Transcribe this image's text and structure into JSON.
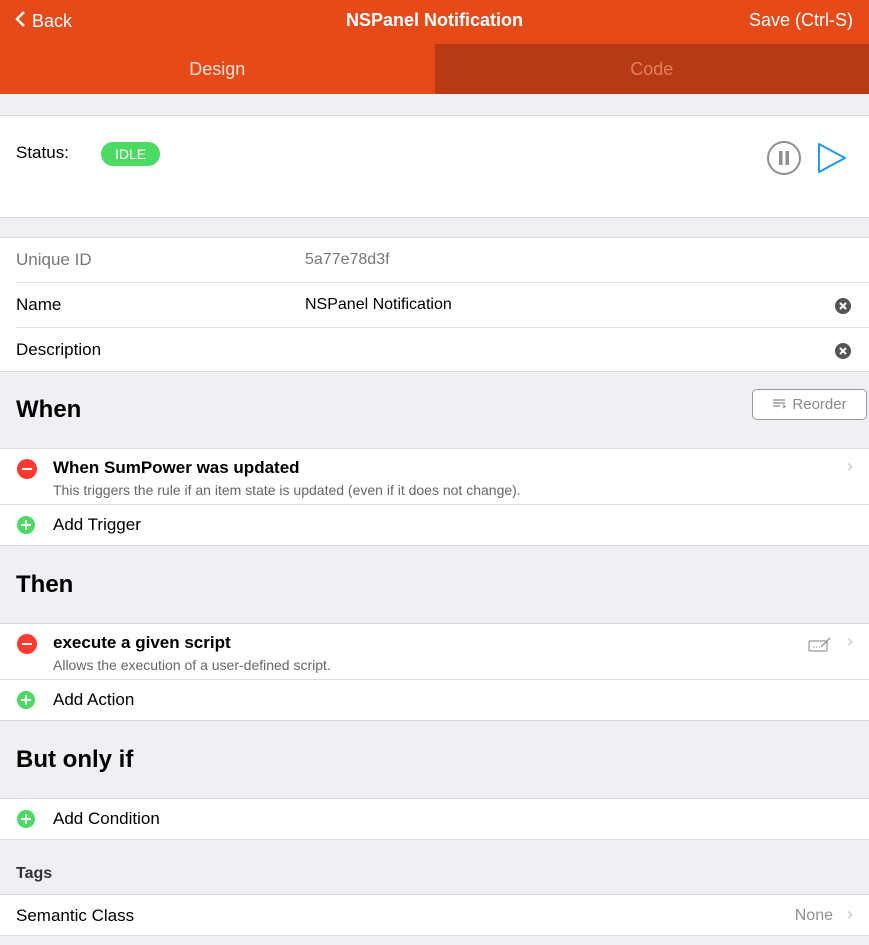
{
  "navbar": {
    "back_label": "Back",
    "title": "NSPanel Notification",
    "save_label": "Save (Ctrl-S)"
  },
  "tabs": [
    {
      "label": "Design",
      "active": true
    },
    {
      "label": "Code",
      "active": false
    }
  ],
  "status": {
    "label": "Status:",
    "badge": "IDLE"
  },
  "info": {
    "unique_id_label": "Unique ID",
    "unique_id_value": "5a77e78d3f",
    "name_label": "Name",
    "name_value": "NSPanel Notification",
    "description_label": "Description",
    "description_value": ""
  },
  "when": {
    "title": "When",
    "reorder_label": "Reorder",
    "trigger_title": "When SumPower was updated",
    "trigger_desc": "This triggers the rule if an item state is updated (even if it does not change).",
    "add_label": "Add Trigger"
  },
  "then": {
    "title": "Then",
    "action_title": "execute a given script",
    "action_desc": "Allows the execution of a user-defined script.",
    "add_label": "Add Action"
  },
  "only_if": {
    "title": "But only if",
    "add_label": "Add Condition"
  },
  "tags": {
    "label": "Tags",
    "semantic_label": "Semantic Class",
    "semantic_value": "None"
  },
  "colors": {
    "accent": "#e64a19",
    "accent_dark": "#b83a12",
    "idle_badge": "#4cd964",
    "remove": "#ff3b30",
    "add": "#4cd964",
    "play": "#2196f3"
  }
}
